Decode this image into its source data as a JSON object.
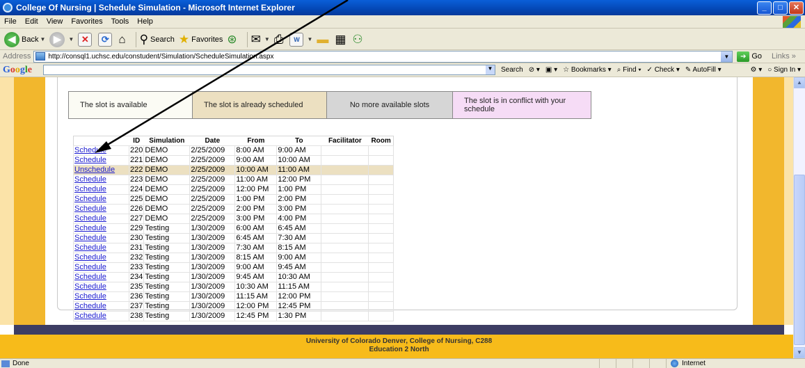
{
  "window": {
    "title": "College Of Nursing | Schedule Simulation - Microsoft Internet Explorer",
    "buttons": {
      "minimize": "_",
      "maximize": "□",
      "close": "✕"
    }
  },
  "menu": [
    "File",
    "Edit",
    "View",
    "Favorites",
    "Tools",
    "Help"
  ],
  "toolbar": {
    "back": "Back",
    "search": "Search",
    "favorites": "Favorites"
  },
  "address": {
    "label": "Address",
    "url": "http://consql1.uchsc.edu/constudent/Simulation/ScheduleSimulation.aspx",
    "go": "Go",
    "links": "Links »"
  },
  "google": {
    "logo": [
      "G",
      "o",
      "o",
      "g",
      "l",
      "e"
    ],
    "search": "Search",
    "bookmarks": "Bookmarks",
    "find": "Find",
    "check": "Check",
    "autofill": "AutoFill",
    "signin": "Sign In"
  },
  "legend": {
    "available": "The slot is available",
    "scheduled": "The slot is already scheduled",
    "full": "No more available slots",
    "conflict": "The slot is in conflict with your schedule"
  },
  "table": {
    "headers": [
      "ID",
      "Simulation",
      "Date",
      "From",
      "To",
      "Facilitator",
      "Room"
    ],
    "rows": [
      {
        "action": "Schedule",
        "id": "220",
        "sim": "DEMO",
        "date": "2/25/2009",
        "from": "8:00 AM",
        "to": "9:00 AM"
      },
      {
        "action": "Schedule",
        "id": "221",
        "sim": "DEMO",
        "date": "2/25/2009",
        "from": "9:00 AM",
        "to": "10:00 AM"
      },
      {
        "action": "Unschedule",
        "id": "222",
        "sim": "DEMO",
        "date": "2/25/2009",
        "from": "10:00 AM",
        "to": "11:00 AM"
      },
      {
        "action": "Schedule",
        "id": "223",
        "sim": "DEMO",
        "date": "2/25/2009",
        "from": "11:00 AM",
        "to": "12:00 PM"
      },
      {
        "action": "Schedule",
        "id": "224",
        "sim": "DEMO",
        "date": "2/25/2009",
        "from": "12:00 PM",
        "to": "1:00 PM"
      },
      {
        "action": "Schedule",
        "id": "225",
        "sim": "DEMO",
        "date": "2/25/2009",
        "from": "1:00 PM",
        "to": "2:00 PM"
      },
      {
        "action": "Schedule",
        "id": "226",
        "sim": "DEMO",
        "date": "2/25/2009",
        "from": "2:00 PM",
        "to": "3:00 PM"
      },
      {
        "action": "Schedule",
        "id": "227",
        "sim": "DEMO",
        "date": "2/25/2009",
        "from": "3:00 PM",
        "to": "4:00 PM"
      },
      {
        "action": "Schedule",
        "id": "229",
        "sim": "Testing",
        "date": "1/30/2009",
        "from": "6:00 AM",
        "to": "6:45 AM"
      },
      {
        "action": "Schedule",
        "id": "230",
        "sim": "Testing",
        "date": "1/30/2009",
        "from": "6:45 AM",
        "to": "7:30 AM"
      },
      {
        "action": "Schedule",
        "id": "231",
        "sim": "Testing",
        "date": "1/30/2009",
        "from": "7:30 AM",
        "to": "8:15 AM"
      },
      {
        "action": "Schedule",
        "id": "232",
        "sim": "Testing",
        "date": "1/30/2009",
        "from": "8:15 AM",
        "to": "9:00 AM"
      },
      {
        "action": "Schedule",
        "id": "233",
        "sim": "Testing",
        "date": "1/30/2009",
        "from": "9:00 AM",
        "to": "9:45 AM"
      },
      {
        "action": "Schedule",
        "id": "234",
        "sim": "Testing",
        "date": "1/30/2009",
        "from": "9:45 AM",
        "to": "10:30 AM"
      },
      {
        "action": "Schedule",
        "id": "235",
        "sim": "Testing",
        "date": "1/30/2009",
        "from": "10:30 AM",
        "to": "11:15 AM"
      },
      {
        "action": "Schedule",
        "id": "236",
        "sim": "Testing",
        "date": "1/30/2009",
        "from": "11:15 AM",
        "to": "12:00 PM"
      },
      {
        "action": "Schedule",
        "id": "237",
        "sim": "Testing",
        "date": "1/30/2009",
        "from": "12:00 PM",
        "to": "12:45 PM"
      },
      {
        "action": "Schedule",
        "id": "238",
        "sim": "Testing",
        "date": "1/30/2009",
        "from": "12:45 PM",
        "to": "1:30 PM"
      }
    ]
  },
  "footer": {
    "line1": "University of Colorado Denver, College of Nursing, C288",
    "line2": "Education 2 North"
  },
  "status": {
    "left": "Done",
    "zone": "Internet"
  },
  "colors": {
    "band": "#f2b72d",
    "scheduled_row": "#ece0c1",
    "link": "#1a1ad0"
  }
}
